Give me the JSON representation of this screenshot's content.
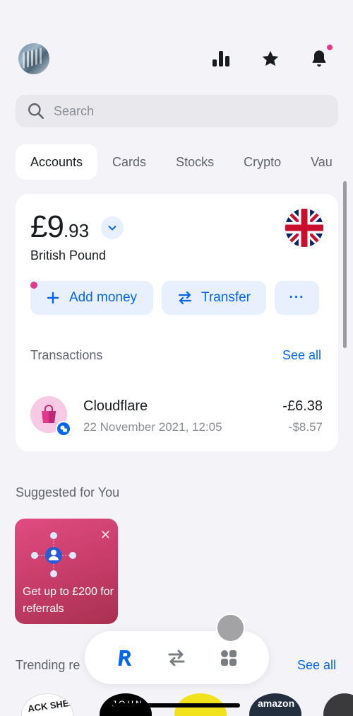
{
  "header": {
    "analytics_icon": "bar-chart-icon",
    "star_icon": "star-icon",
    "bell_icon": "bell-icon",
    "notification_color": "#e0398d"
  },
  "search": {
    "placeholder": "Search"
  },
  "tabs": [
    {
      "label": "Accounts",
      "active": true
    },
    {
      "label": "Cards"
    },
    {
      "label": "Stocks"
    },
    {
      "label": "Crypto"
    },
    {
      "label": "Vau"
    }
  ],
  "account": {
    "balance_main": "£9",
    "balance_decimal": ".93",
    "currency_name": "British Pound",
    "flag_icon": "uk-flag-icon",
    "actions": {
      "add_money": "Add money",
      "transfer": "Transfer",
      "more": "···"
    }
  },
  "transactions": {
    "heading": "Transactions",
    "see_all": "See all",
    "items": [
      {
        "name": "Cloudflare",
        "date": "22 November 2021, 12:05",
        "amount": "-£6.38",
        "amount_secondary": "-$8.57"
      }
    ]
  },
  "suggested": {
    "heading": "Suggested for You",
    "promo_text": "Get up to £200 for referrals",
    "close": "✕"
  },
  "trending": {
    "heading": "Trending re",
    "see_all": "See all",
    "logos": [
      {
        "text": "ACK SHEEP"
      },
      {
        "text": "JOHN"
      },
      {
        "text": ""
      },
      {
        "text": "amazon"
      },
      {
        "text": ""
      }
    ]
  },
  "bottom_nav": {
    "items": [
      "home-r-icon",
      "transfer-arrows-icon",
      "hub-grid-icon"
    ]
  },
  "colors": {
    "accent": "#0666eb",
    "background": "#f4f3f8",
    "promo": "#c23a66"
  }
}
